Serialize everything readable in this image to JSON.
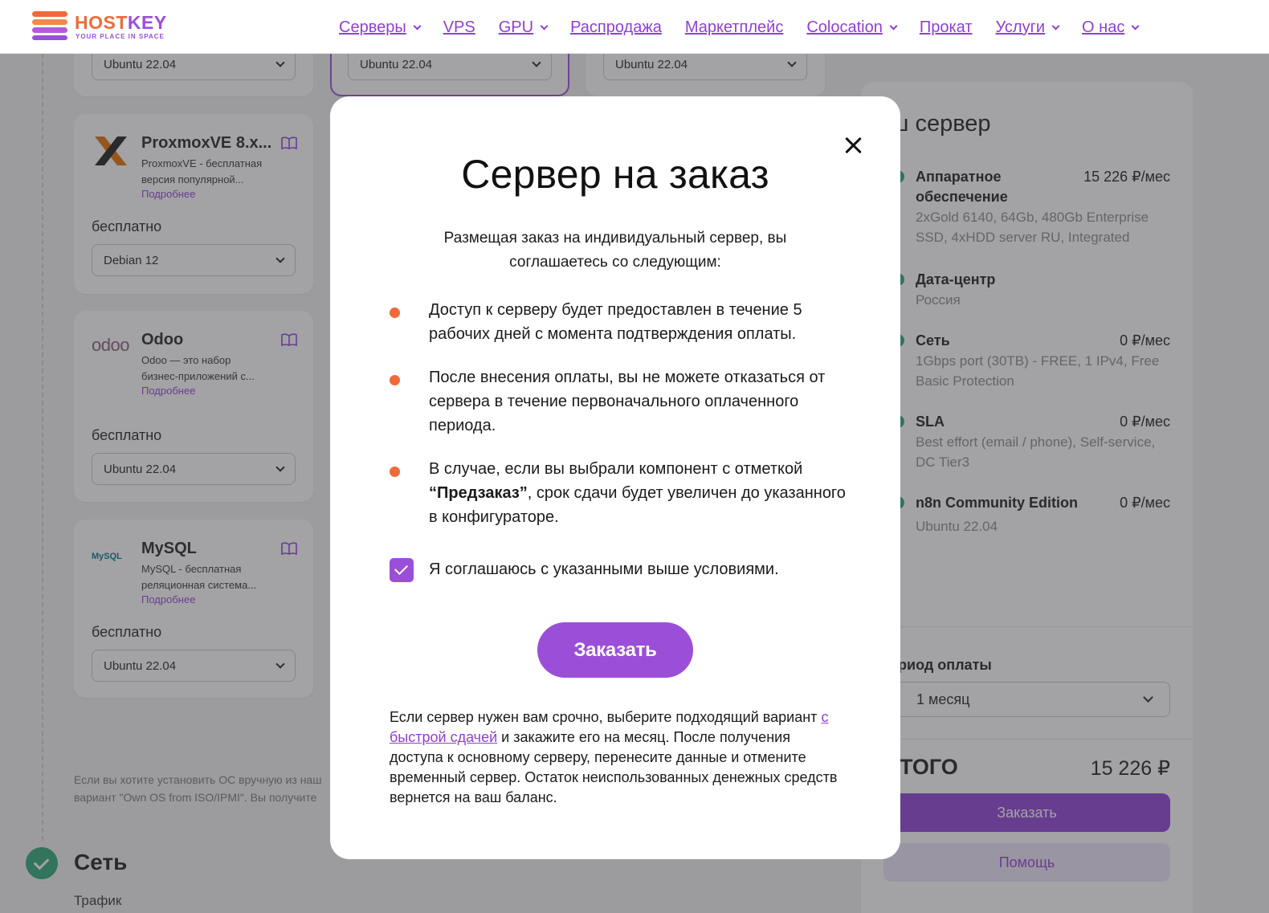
{
  "header": {
    "logo_name_a": "HOST",
    "logo_name_b": "KEY",
    "logo_tagline": "YOUR PLACE IN SPACE",
    "nav": [
      {
        "label": "Серверы",
        "has_dropdown": true
      },
      {
        "label": "VPS",
        "has_dropdown": false
      },
      {
        "label": "GPU",
        "has_dropdown": true
      },
      {
        "label": "Распродажа",
        "has_dropdown": false
      },
      {
        "label": "Маркетплейс",
        "has_dropdown": false
      },
      {
        "label": "Colocation",
        "has_dropdown": true
      },
      {
        "label": "Прокат",
        "has_dropdown": false
      },
      {
        "label": "Услуги",
        "has_dropdown": true
      },
      {
        "label": "О нас",
        "has_dropdown": true
      }
    ]
  },
  "marketplace": {
    "top_selects": [
      "Ubuntu 22.04",
      "Ubuntu 22.04",
      "Ubuntu 22.04"
    ],
    "apps": [
      {
        "name": "ProxmoxVE 8.x...",
        "desc": "ProxmoxVE - бесплатная версия популярной...",
        "more": "Подробнее",
        "price": "бесплатно",
        "os": "Debian 12",
        "icon": "proxmox-logo-icon"
      },
      {
        "name": "Odoo",
        "desc": "Odoo — это набор бизнес-приложений с...",
        "more": "Подробнее",
        "price": "бесплатно",
        "os": "Ubuntu 22.04",
        "icon": "odoo-logo-icon",
        "logo_text": "odoo"
      },
      {
        "name": "MySQL",
        "desc": "MySQL - бесплатная реляционная система...",
        "more": "Подробнее",
        "price": "бесплатно",
        "os": "Ubuntu 22.04",
        "icon": "mysql-logo-icon",
        "logo_text": "MySQL"
      }
    ],
    "note_line1": "Если вы хотите установить ОС вручную из наш",
    "note_line2": "вариант \"Own OS from ISO/IPMI\". Вы получите",
    "next_step_title": "Сеть",
    "next_step_sub": "Трафик"
  },
  "summary": {
    "title": "аш сервер",
    "rows": [
      {
        "label": "Аппаратное обеспечение",
        "price": "15 226 ₽/мес",
        "detail": "2xGold 6140, 64Gb, 480Gb Enterprise SSD, 4xHDD server RU, Integrated"
      },
      {
        "label": "Дата-центр",
        "price": "",
        "detail": "Россия"
      },
      {
        "label": "Сеть",
        "price": "0 ₽/мес",
        "detail": "1Gbps port (30TB) - FREE, 1 IPv4, Free Basic Protection"
      },
      {
        "label": "SLA",
        "price": "0 ₽/мес",
        "detail": "Best effort (email / phone), Self-service, DC Tier3"
      },
      {
        "label": "n8n Community Edition",
        "price": "0 ₽/мес",
        "detail": "Ubuntu 22.04"
      }
    ],
    "period_label": "ериод оплаты",
    "period_value": "1 месяц",
    "total_label": "ТОГО",
    "total_value": "15 226 ₽",
    "order_label": "Заказать",
    "help_label": "Помощь"
  },
  "modal": {
    "title": "Сервер на заказ",
    "intro": "Размещая заказ на индивидуальный сервер, вы соглашаетесь со следующим:",
    "conditions": [
      {
        "text": "Доступ к серверу будет предоставлен в течение 5 рабочих дней с момента подтверждения оплаты."
      },
      {
        "text": "После внесения оплаты, вы не можете отказаться от сервера в течение первоначального оплаченного периода."
      },
      {
        "prefix": "В случае, если вы выбрали компонент с отметкой ",
        "bold": "“Предзаказ”",
        "suffix": ", срок сдачи будет увеличен до указанного в конфигураторе."
      }
    ],
    "agree_label": "Я соглашаюсь с указанными выше условиями.",
    "agree_checked": true,
    "order_button": "Заказать",
    "footer_before": "Если сервер нужен вам срочно, выберите подходящий вариант ",
    "footer_link": "с быстрой сдачей",
    "footer_after": " и закажите его на месяц. После получения доступа к основному серверу, перенесите данные и отмените временный сервер. Остаток неиспользованных денежных средств вернется на ваш баланс."
  },
  "colors": {
    "brand_orange": "#ef6a3a",
    "brand_purple": "#9b4fd8",
    "status_green": "#2aa775"
  }
}
